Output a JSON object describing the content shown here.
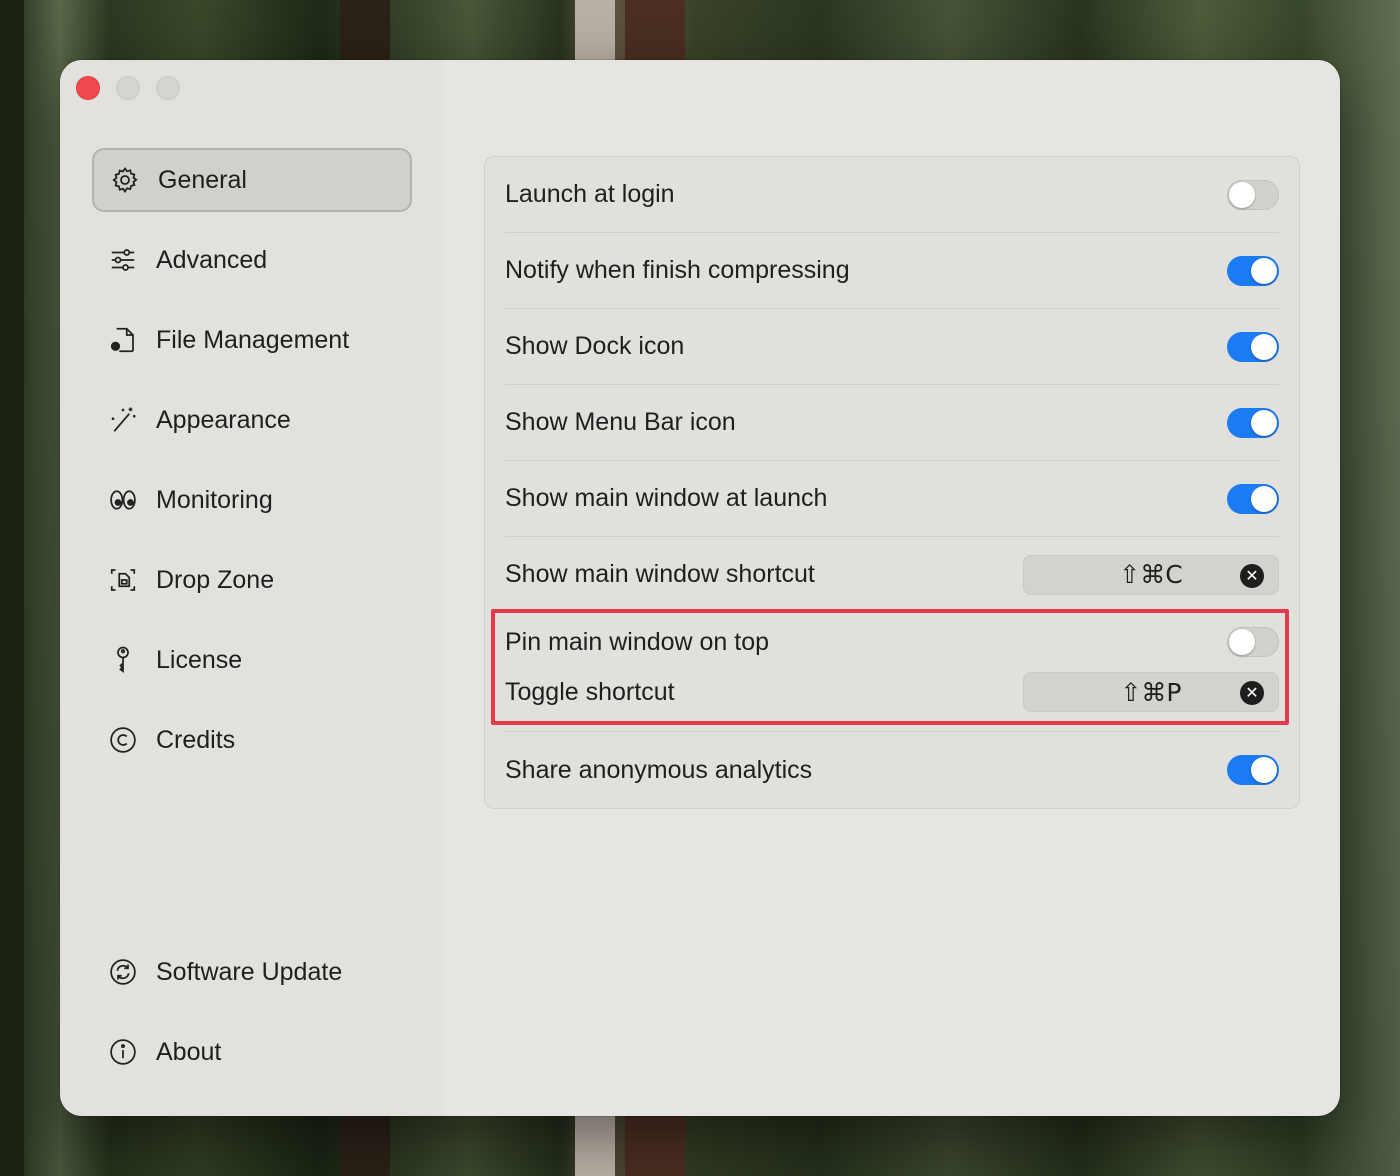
{
  "window": {
    "traffic_lights": [
      "close",
      "minimize",
      "zoom"
    ]
  },
  "sidebar": {
    "items": [
      {
        "label": "General",
        "icon": "gear-icon",
        "active": true
      },
      {
        "label": "Advanced",
        "icon": "sliders-icon",
        "active": false
      },
      {
        "label": "File Management",
        "icon": "document-gear-icon",
        "active": false
      },
      {
        "label": "Appearance",
        "icon": "magic-wand-icon",
        "active": false
      },
      {
        "label": "Monitoring",
        "icon": "eyes-icon",
        "active": false
      },
      {
        "label": "Drop Zone",
        "icon": "drop-zone-icon",
        "active": false
      },
      {
        "label": "License",
        "icon": "key-icon",
        "active": false
      },
      {
        "label": "Credits",
        "icon": "copyright-icon",
        "active": false
      }
    ],
    "bottom_items": [
      {
        "label": "Software Update",
        "icon": "refresh-icon"
      },
      {
        "label": "About",
        "icon": "info-icon"
      }
    ]
  },
  "settings": {
    "launch_at_login": {
      "label": "Launch at login",
      "on": false
    },
    "notify_finish": {
      "label": "Notify when finish compressing",
      "on": true
    },
    "show_dock_icon": {
      "label": "Show Dock icon",
      "on": true
    },
    "show_menu_bar_icon": {
      "label": "Show Menu Bar icon",
      "on": true
    },
    "show_main_window_launch": {
      "label": "Show main window at launch",
      "on": true
    },
    "show_main_window_shortcut": {
      "label": "Show main window shortcut",
      "shortcut": "⇧⌘C"
    },
    "pin_main_window": {
      "label": "Pin main window on top",
      "on": false
    },
    "toggle_shortcut": {
      "label": "Toggle shortcut",
      "shortcut": "⇧⌘P"
    },
    "share_analytics": {
      "label": "Share anonymous analytics",
      "on": true
    },
    "clear_symbol": "✕"
  },
  "colors": {
    "accent": "#1a7bf2",
    "highlight_border": "#e5394d",
    "close_button": "#ee4a4f"
  }
}
